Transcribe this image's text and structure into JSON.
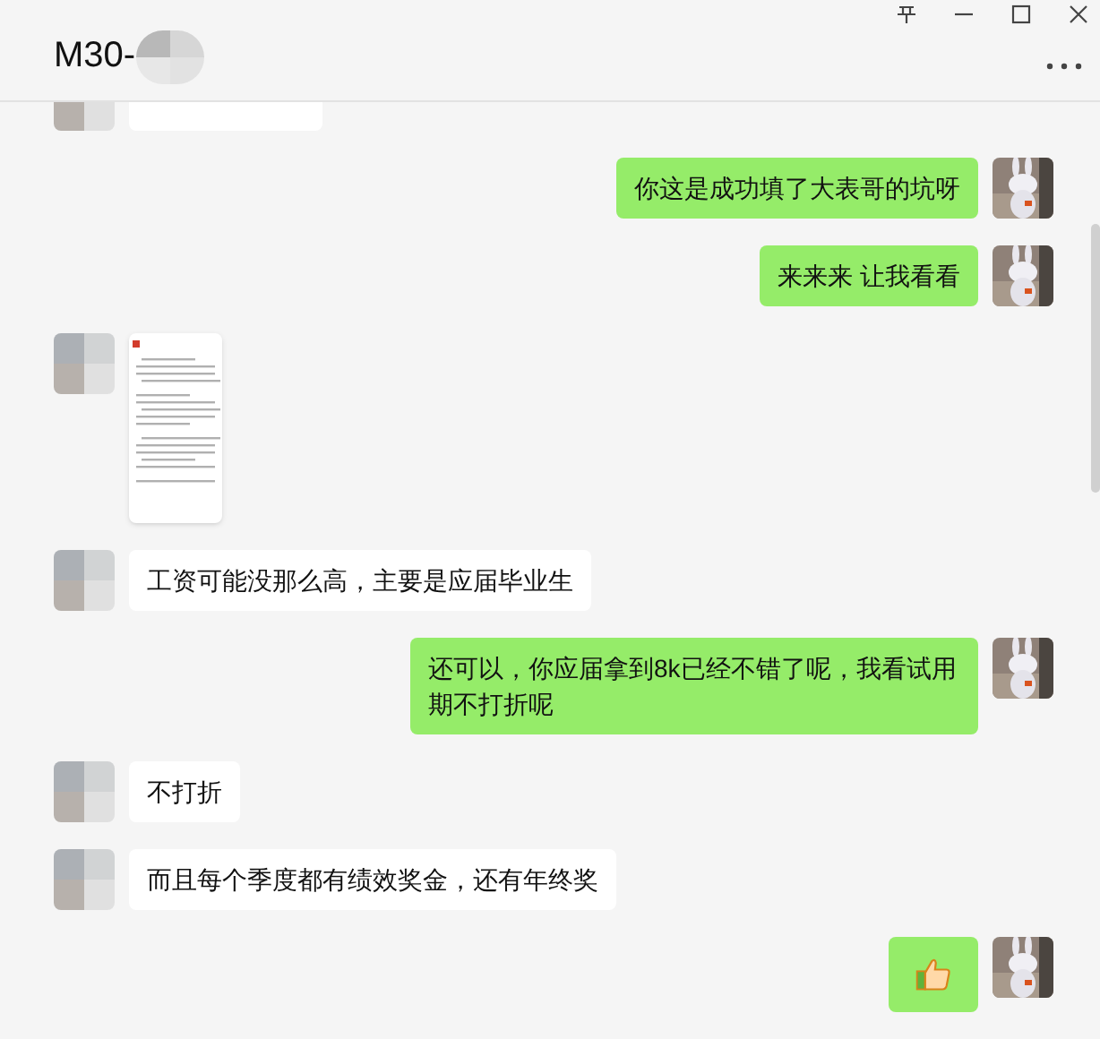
{
  "window": {
    "title": "M30-"
  },
  "messages": [
    {
      "outgoing": false,
      "kind": "cut"
    },
    {
      "outgoing": true,
      "kind": "text",
      "text": "你这是成功填了大表哥的坑呀"
    },
    {
      "outgoing": true,
      "kind": "text",
      "text": "来来来  让我看看"
    },
    {
      "outgoing": false,
      "kind": "document"
    },
    {
      "outgoing": false,
      "kind": "text",
      "text": "工资可能没那么高，主要是应届毕业生"
    },
    {
      "outgoing": true,
      "kind": "text",
      "text": "还可以，你应届拿到8k已经不错了呢，我看试用期不打折呢"
    },
    {
      "outgoing": false,
      "kind": "text",
      "text": "不打折"
    },
    {
      "outgoing": false,
      "kind": "text",
      "text": "而且每个季度都有绩效奖金，还有年终奖"
    },
    {
      "outgoing": true,
      "kind": "thumbs"
    }
  ]
}
